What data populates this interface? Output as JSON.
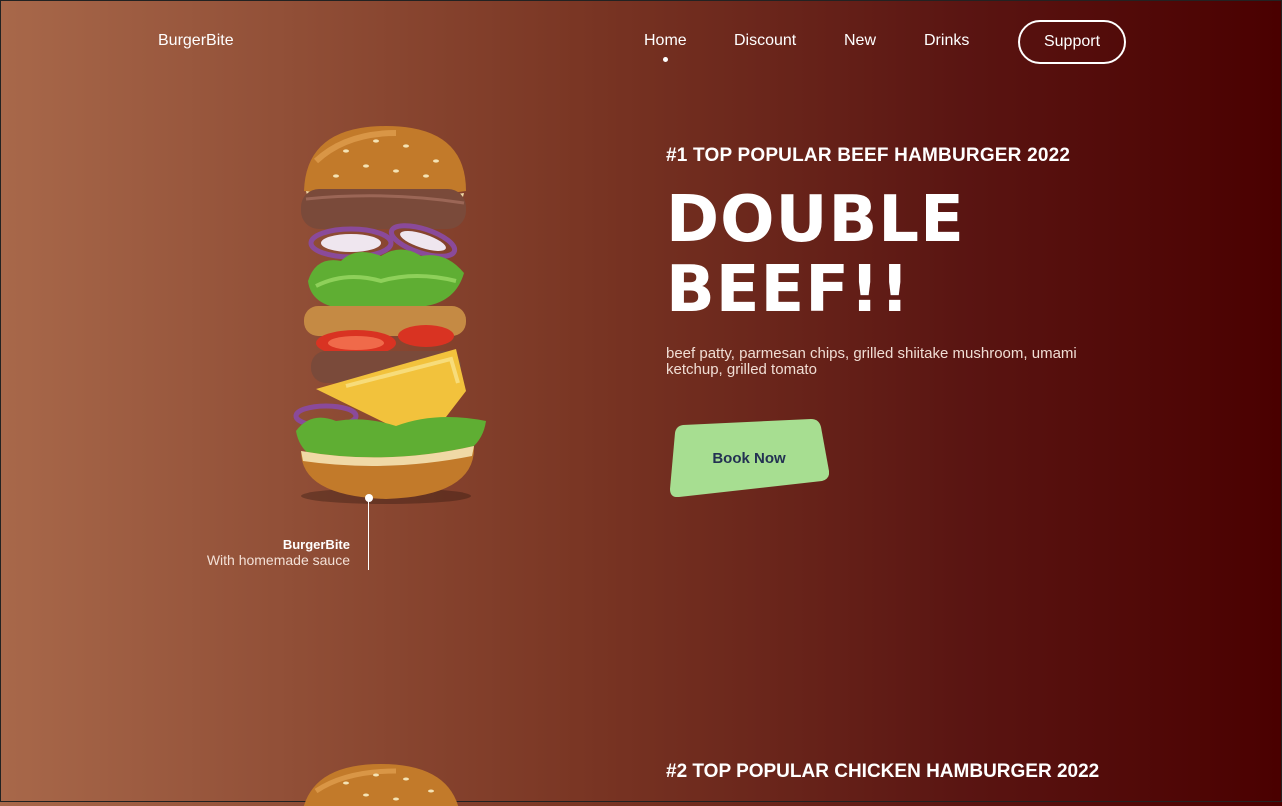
{
  "header": {
    "brand": "BurgerBite",
    "nav": [
      {
        "label": "Home"
      },
      {
        "label": "Discount"
      },
      {
        "label": "New"
      },
      {
        "label": "Drinks"
      }
    ],
    "support_label": "Support"
  },
  "hero": {
    "kicker": "#1 TOP POPULAR BEEF HAMBURGER 2022",
    "headline_line1": "DOUBLE",
    "headline_line2": "BEEF!!",
    "description": "beef patty, parmesan chips, grilled shiitake mushroom, umami ketchup, grilled tomato",
    "cta_label": "Book Now",
    "cta_color": "#a7de91",
    "caption_title": "BurgerBite",
    "caption_sub": "With homemade sauce"
  },
  "next_section": {
    "kicker": "#2 TOP POPULAR CHICKEN HAMBURGER 2022"
  }
}
